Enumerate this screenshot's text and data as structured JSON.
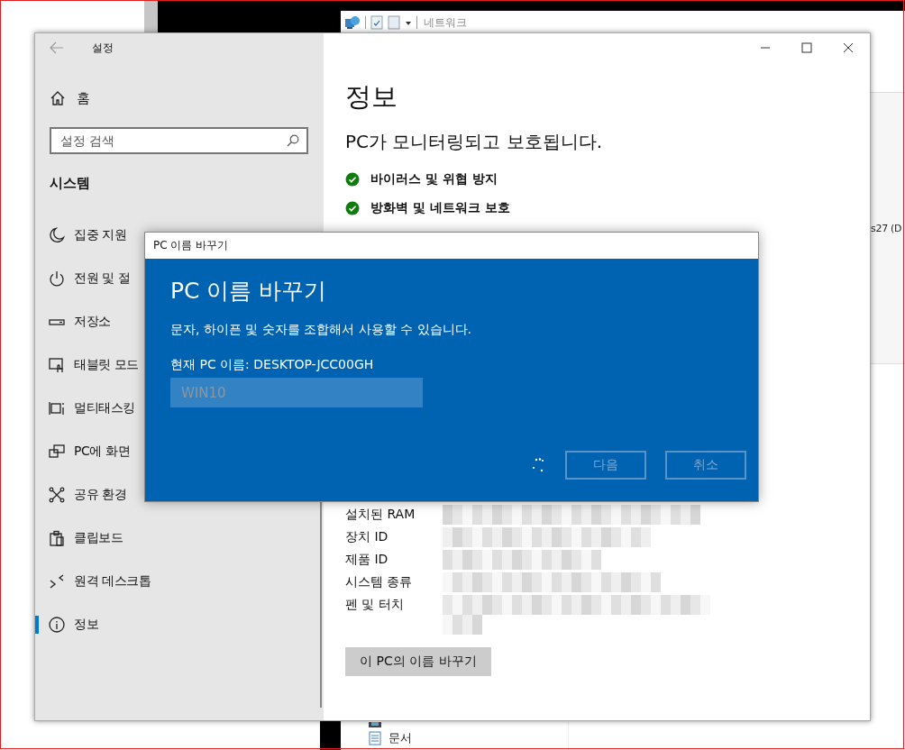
{
  "explorer": {
    "address": "네트워크",
    "side_text": "s27 (D",
    "nav_items": [
      {
        "label": "문서"
      }
    ]
  },
  "settings": {
    "title": "설정",
    "home": "홈",
    "search": {
      "placeholder": "설정 검색"
    },
    "section": "시스템",
    "nav": [
      {
        "label": "집중 지원",
        "kind": "moon",
        "selected": false
      },
      {
        "label": "전원 및 절",
        "kind": "power",
        "selected": false
      },
      {
        "label": "저장소",
        "kind": "storage",
        "selected": false
      },
      {
        "label": "태블릿 모드",
        "kind": "tablet",
        "selected": false
      },
      {
        "label": "멀티태스킹",
        "kind": "multitask",
        "selected": false
      },
      {
        "label": "PC에 화면",
        "kind": "project",
        "selected": false
      },
      {
        "label": "공유 환경",
        "kind": "share",
        "selected": false
      },
      {
        "label": "클립보드",
        "kind": "clipboard",
        "selected": false
      },
      {
        "label": "원격 데스크톱",
        "kind": "remote",
        "selected": false
      },
      {
        "label": "정보",
        "kind": "info",
        "selected": true
      }
    ],
    "page_title": "정보",
    "protection_heading": "PC가 모니터링되고 보호됩니다.",
    "protection": [
      {
        "label": "바이러스 및 위협 방지"
      },
      {
        "label": "방화벽 및 네트워크 보호"
      }
    ],
    "specs": [
      {
        "label": "설치된 RAM"
      },
      {
        "label": "장치 ID"
      },
      {
        "label": "제품 ID"
      },
      {
        "label": "시스템 종류"
      },
      {
        "label": "펜 및 터치"
      }
    ],
    "rename_button": "이 PC의 이름 바꾸기"
  },
  "dialog": {
    "title": "PC 이름 바꾸기",
    "heading": "PC 이름 바꾸기",
    "description": "문자, 하이픈 및 숫자를 조합해서 사용할 수 있습니다.",
    "current_name": "현재 PC 이름: DESKTOP-JCC00GH",
    "name_field": {
      "value": "WIN10",
      "disabled": true
    },
    "busy": true,
    "buttons": [
      {
        "label": "다음",
        "disabled": true
      },
      {
        "label": "취소",
        "disabled": true
      }
    ]
  }
}
